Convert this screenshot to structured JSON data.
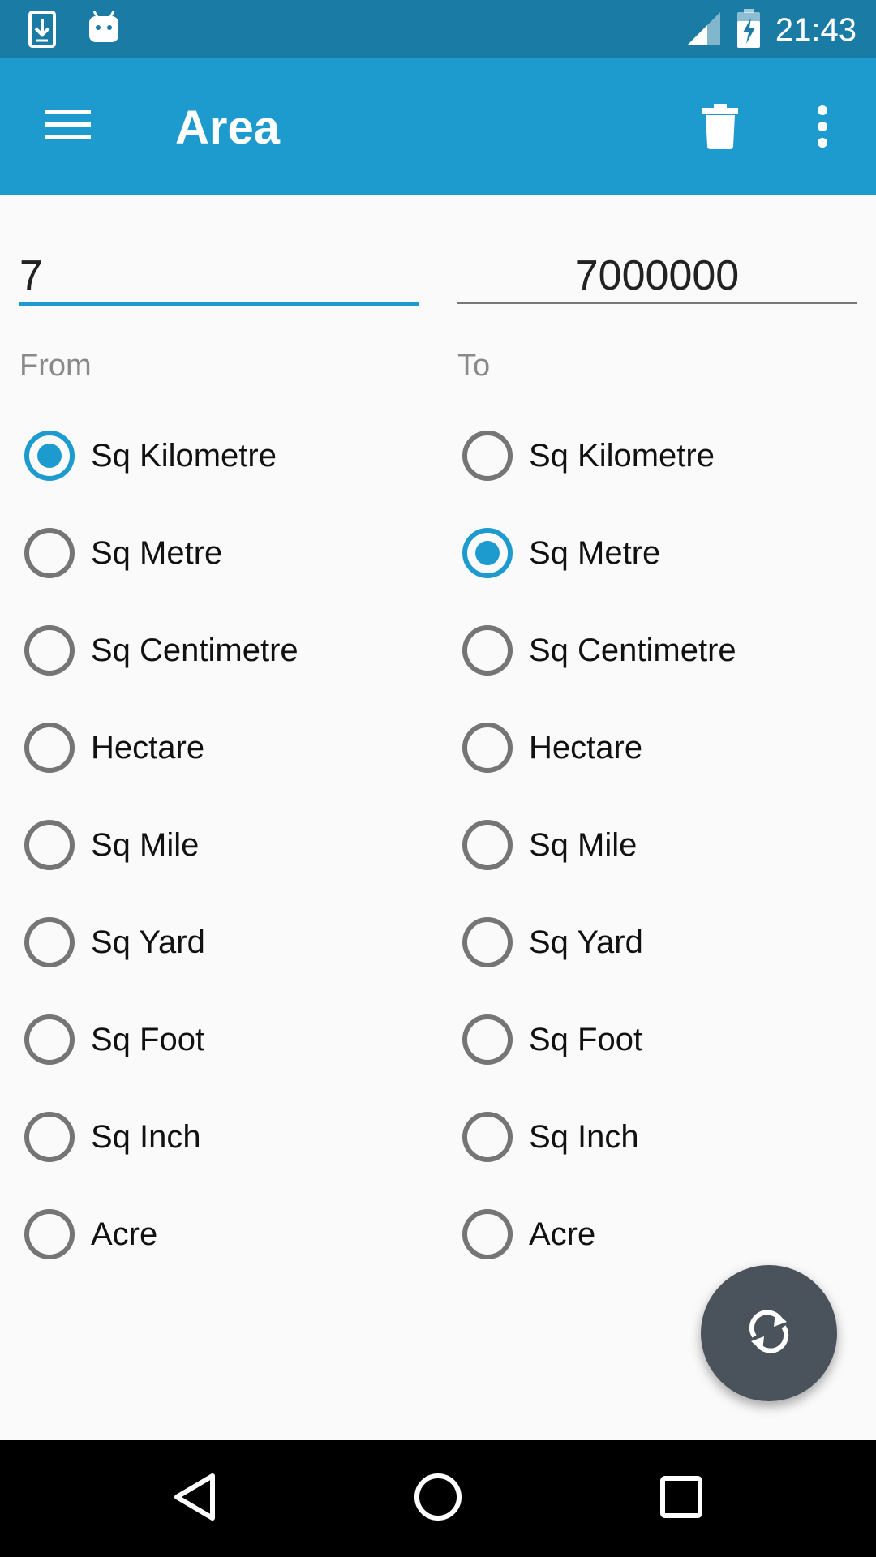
{
  "status_bar": {
    "time": "21:43",
    "left_icons": [
      "download-icon",
      "android-icon"
    ],
    "right_icons": [
      "signal-icon",
      "battery-charging-icon"
    ]
  },
  "app_bar": {
    "title": "Area",
    "menu_icon": "hamburger-menu-icon",
    "delete_icon": "trash-icon",
    "more_icon": "more-vert-icon",
    "color": "#1e9bce"
  },
  "inputs": {
    "from_value": "7",
    "to_value": "7000000"
  },
  "labels": {
    "from": "From",
    "to": "To"
  },
  "units": [
    "Sq Kilometre",
    "Sq Metre",
    "Sq Centimetre",
    "Hectare",
    "Sq Mile",
    "Sq Yard",
    "Sq Foot",
    "Sq Inch",
    "Acre"
  ],
  "selected": {
    "from": "Sq Kilometre",
    "to": "Sq Metre"
  },
  "fab": {
    "icon": "swap-refresh-icon",
    "color": "#4a535b"
  },
  "nav_bar": {
    "icons": [
      "back-icon",
      "home-icon",
      "recent-apps-icon"
    ]
  }
}
